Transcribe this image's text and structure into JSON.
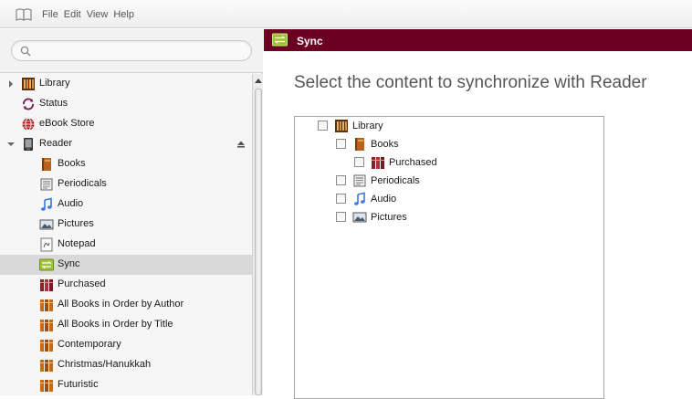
{
  "menubar": {
    "app_icon": "open-book-icon",
    "items": [
      "File",
      "Edit",
      "View",
      "Help"
    ]
  },
  "search": {
    "placeholder": "",
    "value": "",
    "icon": "search-icon"
  },
  "sidebar": {
    "items": [
      {
        "label": "Library",
        "icon": "library-icon",
        "level": 0,
        "expandable": true,
        "expanded": false
      },
      {
        "label": "Status",
        "icon": "status-sync-icon",
        "level": 0
      },
      {
        "label": "eBook Store",
        "icon": "globe-icon",
        "level": 0
      },
      {
        "label": "Reader",
        "icon": "reader-device-icon",
        "level": 0,
        "expandable": true,
        "expanded": true,
        "eject": true
      },
      {
        "label": "Books",
        "icon": "book-icon",
        "level": 1
      },
      {
        "label": "Periodicals",
        "icon": "periodical-icon",
        "level": 1
      },
      {
        "label": "Audio",
        "icon": "music-note-icon",
        "level": 1
      },
      {
        "label": "Pictures",
        "icon": "picture-icon",
        "level": 1
      },
      {
        "label": "Notepad",
        "icon": "notepad-icon",
        "level": 1
      },
      {
        "label": "Sync",
        "icon": "sync-icon",
        "level": 1,
        "selected": true
      },
      {
        "label": "Purchased",
        "icon": "purchased-books-icon",
        "level": 1
      },
      {
        "label": "All Books in Order by Author",
        "icon": "collection-icon",
        "level": 1
      },
      {
        "label": "All Books in Order by Title",
        "icon": "collection-icon",
        "level": 1
      },
      {
        "label": "Contemporary",
        "icon": "collection-icon",
        "level": 1
      },
      {
        "label": "Christmas/Hanukkah",
        "icon": "collection-icon",
        "level": 1
      },
      {
        "label": "Futuristic",
        "icon": "collection-icon",
        "level": 1
      }
    ]
  },
  "main": {
    "header_title": "Sync",
    "header_color": "#6b0022",
    "title": "Select the content to synchronize with Reader",
    "sync_tree": [
      {
        "label": "Library",
        "icon": "library-icon",
        "level": 0,
        "checked": false
      },
      {
        "label": "Books",
        "icon": "book-icon",
        "level": 1,
        "checked": false
      },
      {
        "label": "Purchased",
        "icon": "purchased-books-icon",
        "level": 2,
        "checked": false
      },
      {
        "label": "Periodicals",
        "icon": "periodical-icon",
        "level": 1,
        "checked": false
      },
      {
        "label": "Audio",
        "icon": "music-note-icon",
        "level": 1,
        "checked": false
      },
      {
        "label": "Pictures",
        "icon": "picture-icon",
        "level": 1,
        "checked": false
      }
    ]
  }
}
